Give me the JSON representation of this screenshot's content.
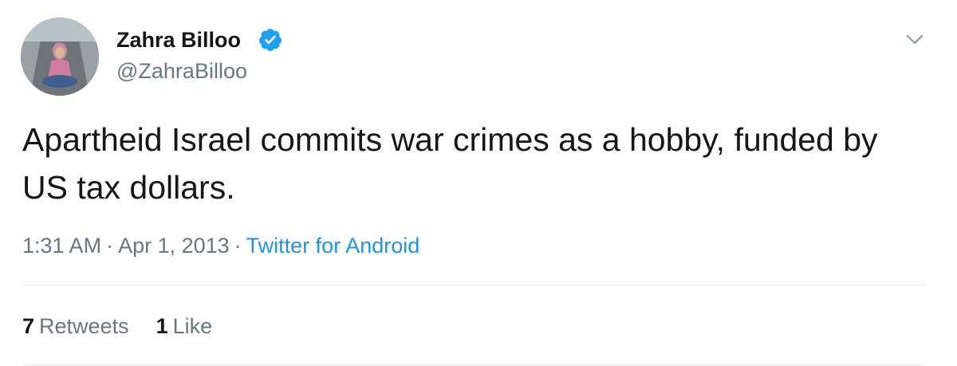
{
  "author": {
    "name": "Zahra Billoo",
    "handle": "@ZahraBilloo",
    "verified": true
  },
  "tweet": {
    "text": "Apartheid Israel commits war crimes as a hobby, funded by US tax dollars.",
    "time": "1:31 AM",
    "separator": "·",
    "date": "Apr 1, 2013",
    "source": "Twitter for Android"
  },
  "stats": {
    "retweets_count": "7",
    "retweets_label": "Retweets",
    "likes_count": "1",
    "likes_label": "Like"
  },
  "icons": {
    "verified": "verified-badge-icon",
    "caret": "chevron-down-icon"
  },
  "colors": {
    "text": "#14171a",
    "secondary": "#657786",
    "link": "#1b95e0",
    "verified": "#1da1f2",
    "divider": "#e6ecf0"
  }
}
